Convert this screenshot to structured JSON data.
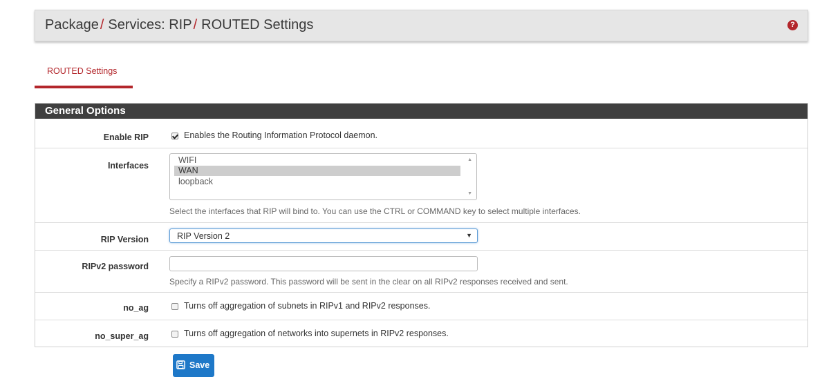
{
  "header": {
    "breadcrumb": [
      "Package",
      "Services: RIP",
      "ROUTED Settings"
    ],
    "separator": "/",
    "help_icon": "question-circle-icon",
    "accent_color": "#b3262b"
  },
  "tabs": [
    {
      "label": "ROUTED Settings",
      "active": true
    }
  ],
  "panel": {
    "title": "General Options",
    "enable_rip": {
      "label": "Enable RIP",
      "checked": true,
      "text": "Enables the Routing Information Protocol daemon."
    },
    "interfaces": {
      "label": "Interfaces",
      "options": [
        "WIFI",
        "WAN",
        "loopback"
      ],
      "selected": [
        "WAN"
      ],
      "help": "Select the interfaces that RIP will bind to. You can use the CTRL or COMMAND key to select multiple interfaces."
    },
    "rip_version": {
      "label": "RIP Version",
      "value": "RIP Version 2"
    },
    "ripv2_password": {
      "label": "RIPv2 password",
      "value": "",
      "help": "Specify a RIPv2 password. This password will be sent in the clear on all RIPv2 responses received and sent."
    },
    "no_ag": {
      "label": "no_ag",
      "checked": false,
      "text": "Turns off aggregation of subnets in RIPv1 and RIPv2 responses."
    },
    "no_super_ag": {
      "label": "no_super_ag",
      "checked": false,
      "text": "Turns off aggregation of networks into supernets in RIPv2 responses."
    }
  },
  "save_button": {
    "label": "Save",
    "icon": "floppy-disk-icon",
    "color": "#1e78c8"
  }
}
